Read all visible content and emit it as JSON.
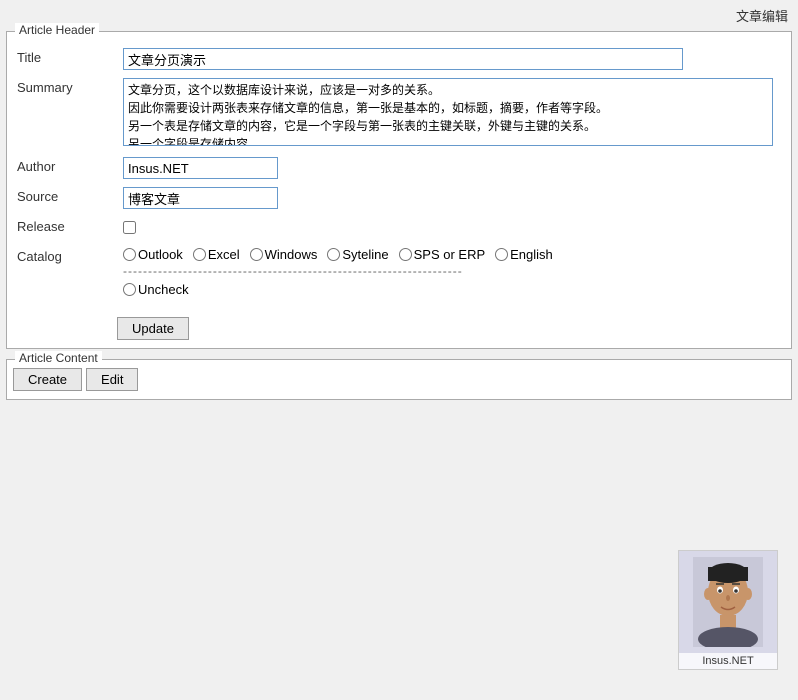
{
  "page": {
    "header_title": "文章编辑",
    "article_header_legend": "Article Header",
    "article_content_legend": "Article Content"
  },
  "form": {
    "title_label": "Title",
    "title_value": "文章分页演示",
    "summary_label": "Summary",
    "summary_value": "文章分页，这个以数据库设计来说，应该是一对多的关系。\n因此你需要设计两张表来存储文章的信息，第一张是基本的，如标题，摘要，作者等字段。\n另一个表是存储文章的内容，它是一个字段与第一张表的主键关联，外键与主键的关系。\n另一个字段是存储内容。",
    "author_label": "Author",
    "author_value": "Insus.NET",
    "source_label": "Source",
    "source_value": "博客文章",
    "release_label": "Release",
    "catalog_label": "Catalog",
    "catalog_options": [
      {
        "label": "Outlook",
        "name": "catalog",
        "value": "outlook"
      },
      {
        "label": "Excel",
        "name": "catalog",
        "value": "excel"
      },
      {
        "label": "Windows",
        "name": "catalog",
        "value": "windows"
      },
      {
        "label": "Syteline",
        "name": "catalog",
        "value": "syteline"
      },
      {
        "label": "SPS or ERP",
        "name": "catalog",
        "value": "sps_erp"
      },
      {
        "label": "English",
        "name": "catalog",
        "value": "english"
      }
    ],
    "catalog_divider": "--------------------------------------------------------------------",
    "uncheck_label": "Uncheck",
    "update_button": "Update"
  },
  "article_content": {
    "create_button": "Create",
    "edit_button": "Edit"
  },
  "avatar": {
    "label": "Insus.NET"
  }
}
